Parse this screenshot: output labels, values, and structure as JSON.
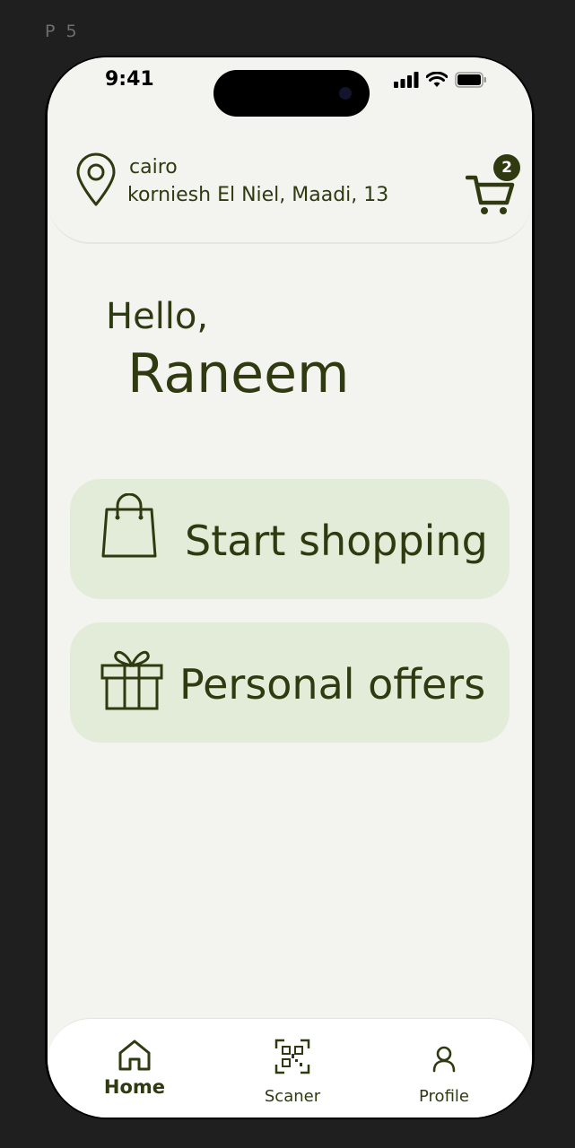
{
  "frame_label": "P 5",
  "status_bar": {
    "time": "9:41"
  },
  "location": {
    "city": "cairo",
    "address": "korniesh El Niel, Maadi, 13"
  },
  "cart": {
    "count": "2"
  },
  "greeting": {
    "hello": "Hello,",
    "name": "Raneem"
  },
  "actions": [
    {
      "label": "Start shopping",
      "icon": "shopping-bag-icon"
    },
    {
      "label": "Personal offers",
      "icon": "gift-icon"
    }
  ],
  "tabbar": {
    "items": [
      {
        "label": "Home",
        "icon": "home-icon",
        "active": true
      },
      {
        "label": "Scaner",
        "icon": "qr-scan-icon",
        "active": false
      },
      {
        "label": "Profile",
        "icon": "user-icon",
        "active": false
      }
    ]
  },
  "colors": {
    "accent": "#2f3a10",
    "card_bg": "#e3ecd8",
    "screen_bg": "#f3f4ef"
  }
}
